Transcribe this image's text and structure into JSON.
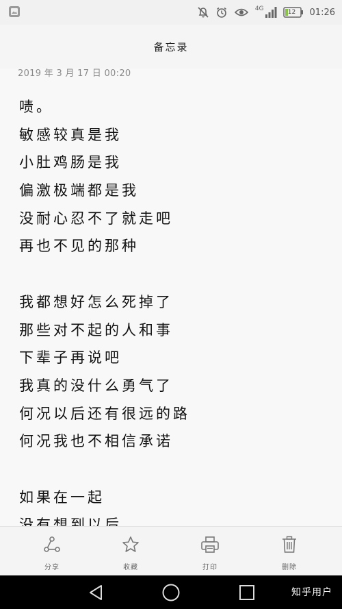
{
  "status_bar": {
    "network": "4G",
    "battery": "12",
    "time": "01:26"
  },
  "header": {
    "title": "备忘录"
  },
  "note": {
    "date": "2019 年 3 月 17 日 00:20",
    "lines": [
      "啧。",
      "敏感较真是我",
      "小肚鸡肠是我",
      "偏激极端都是我",
      "没耐心忍不了就走吧",
      "再也不见的那种",
      "",
      "我都想好怎么死掉了",
      "那些对不起的人和事",
      "下辈子再说吧",
      "我真的没什么勇气了",
      "何况以后还有很远的路",
      "何况我也不相信承诺",
      "",
      "如果在一起",
      "没有想到以后"
    ]
  },
  "toolbar": {
    "share_label": "分享",
    "favorite_label": "收藏",
    "print_label": "打印",
    "delete_label": "删除"
  },
  "watermark": "知乎用户",
  "icons": {
    "share": "share-icon",
    "favorite": "star-icon",
    "print": "printer-icon",
    "delete": "trash-icon",
    "back": "back-triangle-icon",
    "home": "home-circle-icon",
    "recents": "recents-square-icon"
  }
}
